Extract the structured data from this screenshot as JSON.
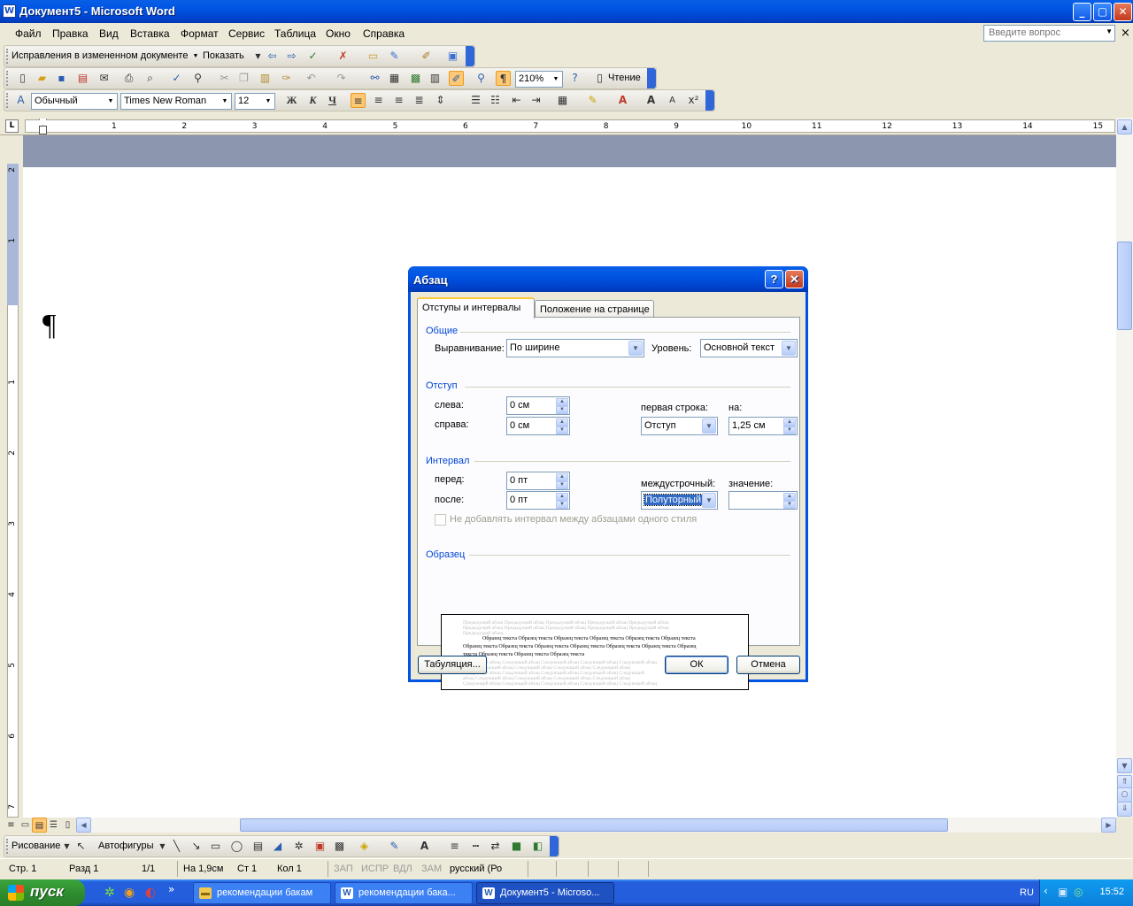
{
  "window": {
    "title": "Документ5 - Microsoft Word",
    "min": "_",
    "max": "▢",
    "close": "✕"
  },
  "menu": {
    "items": [
      "Файл",
      "Правка",
      "Вид",
      "Вставка",
      "Формат",
      "Сервис",
      "Таблица",
      "Окно",
      "Справка"
    ],
    "help_placeholder": "Введите вопрос",
    "close": "×"
  },
  "reviewing": {
    "mode": "Исправления в измененном документе",
    "show": "Показать"
  },
  "standard": {
    "zoom": "210%",
    "read": "Чтение"
  },
  "formatting": {
    "style": "Обычный",
    "font": "Times New Roman",
    "size": "12",
    "bold": "Ж",
    "italic": "К",
    "underline": "Ч"
  },
  "ruler": {
    "h_ticks": [
      "1",
      "2",
      "3",
      "4",
      "5",
      "6",
      "7",
      "8",
      "9",
      "10",
      "11",
      "12",
      "13",
      "14",
      "15"
    ],
    "v_ticks": [
      "2",
      "1",
      "1",
      "2",
      "3",
      "4",
      "5",
      "6",
      "7"
    ]
  },
  "dialog": {
    "title": "Абзац",
    "help": "?",
    "close": "✕",
    "tabs": [
      "Отступы и интервалы",
      "Положение на странице"
    ],
    "general": {
      "legend": "Общие",
      "alignment_label": "Выравнивание:",
      "alignment_value": "По ширине",
      "level_label": "Уровень:",
      "level_value": "Основной текст"
    },
    "indent": {
      "legend": "Отступ",
      "left_label": "слева:",
      "left_value": "0 см",
      "right_label": "справа:",
      "right_value": "0 см",
      "first_line_label": "первая строка:",
      "first_line_value": "Отступ",
      "by_label": "на:",
      "by_value": "1,25 см"
    },
    "spacing": {
      "legend": "Интервал",
      "before_label": "перед:",
      "before_value": "0 пт",
      "after_label": "после:",
      "after_value": "0 пт",
      "line_label": "междустрочный:",
      "line_value": "Полуторный",
      "at_label": "значение:",
      "at_value": "",
      "no_space_label": "Не добавлять интервал между абзацами одного стиля"
    },
    "preview": {
      "legend": "Образец",
      "prev_lines": [
        "Предыдущий абзац Предыдущий абзац Предыдущий абзац Предыдущий абзац Предыдущий абзац",
        "Предыдущий абзац Предыдущий абзац Предыдущий абзац Предыдущий абзац Предыдущий абзац",
        "Предыдущий абзац"
      ],
      "sample_lines": [
        "Образец текста Образец текста Образец текста Образец текста Образец текста Образец текста",
        "Образец текста Образец текста Образец текста Образец текста Образец текста Образец текста Образец",
        "текста Образец текста Образец текста Образец текста"
      ],
      "next_lines": [
        "Следующий абзац Следующий абзац Следующий абзац Следующий абзац Следующий абзац",
        "абзац Следующий абзац Следующий абзац Следующий абзац Следующий абзац",
        "Следующий абзац Следующий абзац Следующий абзац Следующий абзац Следующий",
        "абзац Следующий абзац Следующий абзац Следующий абзац Следующий абзац",
        "Следующий абзац Следующий абзац Следующий абзац Следующий абзац Следующий абзац"
      ]
    },
    "tabs_button": "Табуляция...",
    "ok": "ОК",
    "cancel": "Отмена"
  },
  "drawing": {
    "draw": "Рисование",
    "autoshapes": "Автофигуры"
  },
  "status": {
    "page": "Стр. 1",
    "section": "Разд 1",
    "pages": "1/1",
    "at": "На 1,9см",
    "line": "Ст 1",
    "col": "Кол 1",
    "rec": "ЗАП",
    "trk": "ИСПР",
    "ext": "ВДЛ",
    "ovr": "ЗАМ",
    "lang": "русский (Ро"
  },
  "taskbar": {
    "start": "пуск",
    "tasks": [
      "рекомендации бакам",
      "рекомендации бака...",
      "Документ5 - Microso..."
    ],
    "lang": "RU",
    "clock": "15:52"
  },
  "colors": {
    "xp_blue": "#0054E3",
    "group_title": "#0046D5",
    "selection": "#316AC5"
  }
}
